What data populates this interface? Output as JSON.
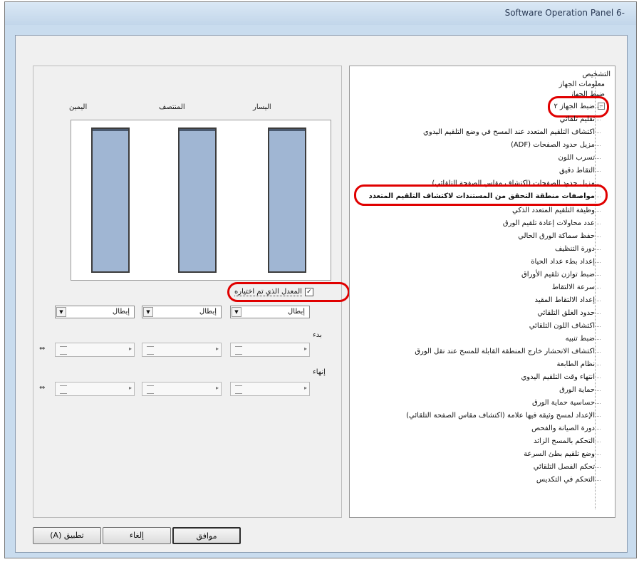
{
  "window": {
    "title": "Software Operation Panel 6-"
  },
  "columns": {
    "left": "اليسار",
    "center": "المنتصف",
    "right": "اليمين"
  },
  "checkbox": {
    "label": "المعدل الذي تم اختياره",
    "mark": "✓"
  },
  "selects": [
    {
      "value": "إبطال"
    },
    {
      "value": "إبطال"
    },
    {
      "value": "إبطال"
    }
  ],
  "labels": {
    "start": "بدء",
    "end": "إنهاء"
  },
  "tree": {
    "items": [
      {
        "label": "التشخيص"
      },
      {
        "label": "معلومات الجهاز"
      },
      {
        "label": "ضبط الجهاز"
      },
      {
        "label": "ضبط الجهاز ٢",
        "expander": "−"
      },
      {
        "label": "تقليم تلقائي"
      },
      {
        "label": "اكتشاف التلقيم المتعدد عند المسح في وضع التلقيم اليدوي"
      },
      {
        "label": "مزيل حدود الصفحات (ADF)"
      },
      {
        "label": "تسرب اللون"
      },
      {
        "label": "التقاط دقيق"
      },
      {
        "label": "مزيل حدود الصفحات (اكتشاف مقاس الصفحة التلقائي)"
      },
      {
        "label": "مواصفات منطقة التحقق من المستندات لاكتشاف التلقيم المتعدد"
      },
      {
        "label": "وظيفة التلقيم المتعدد الذكي"
      },
      {
        "label": "عدد محاولات إعادة تلقيم الورق"
      },
      {
        "label": "حفظ سماكة الورق الحالي"
      },
      {
        "label": "دورة التنظيف"
      },
      {
        "label": "إعداد بطء عداد الحياة"
      },
      {
        "label": "ضبط توازن تلقيم الأوراق"
      },
      {
        "label": "سرعة الالتقاط"
      },
      {
        "label": "إعداد الالتقاط المقيد"
      },
      {
        "label": "حدود الغلق التلقائي"
      },
      {
        "label": "اكتشاف اللون التلقائي"
      },
      {
        "label": "ضبط تنبيه"
      },
      {
        "label": "اكتشاف الانحشار خارج المنطقة القابلة للمسح عند نقل الورق"
      },
      {
        "label": "نظام الطابعة"
      },
      {
        "label": "انتهاء وقت التلقيم اليدوي"
      },
      {
        "label": "حماية الورق"
      },
      {
        "label": "حساسية حماية الورق"
      },
      {
        "label": "الإعداد لمسح وثيقة فيها علامة (اكتشاف مقاس الصفحة التلقائي)"
      },
      {
        "label": "دورة الصيانة والفحص"
      },
      {
        "label": "التحكم بالمسح الزائد"
      },
      {
        "label": "وضع تلقيم بطئ السرعة"
      },
      {
        "label": "تحكم الفصل التلقائي"
      },
      {
        "label": "التحكم في التكديس"
      }
    ]
  },
  "buttons": {
    "ok": "موافق",
    "cancel": "إلغاء",
    "apply": "تطبيق (A)"
  },
  "colors": {
    "highlight": "#e00000",
    "bar_fill": "#a0b6d3"
  }
}
